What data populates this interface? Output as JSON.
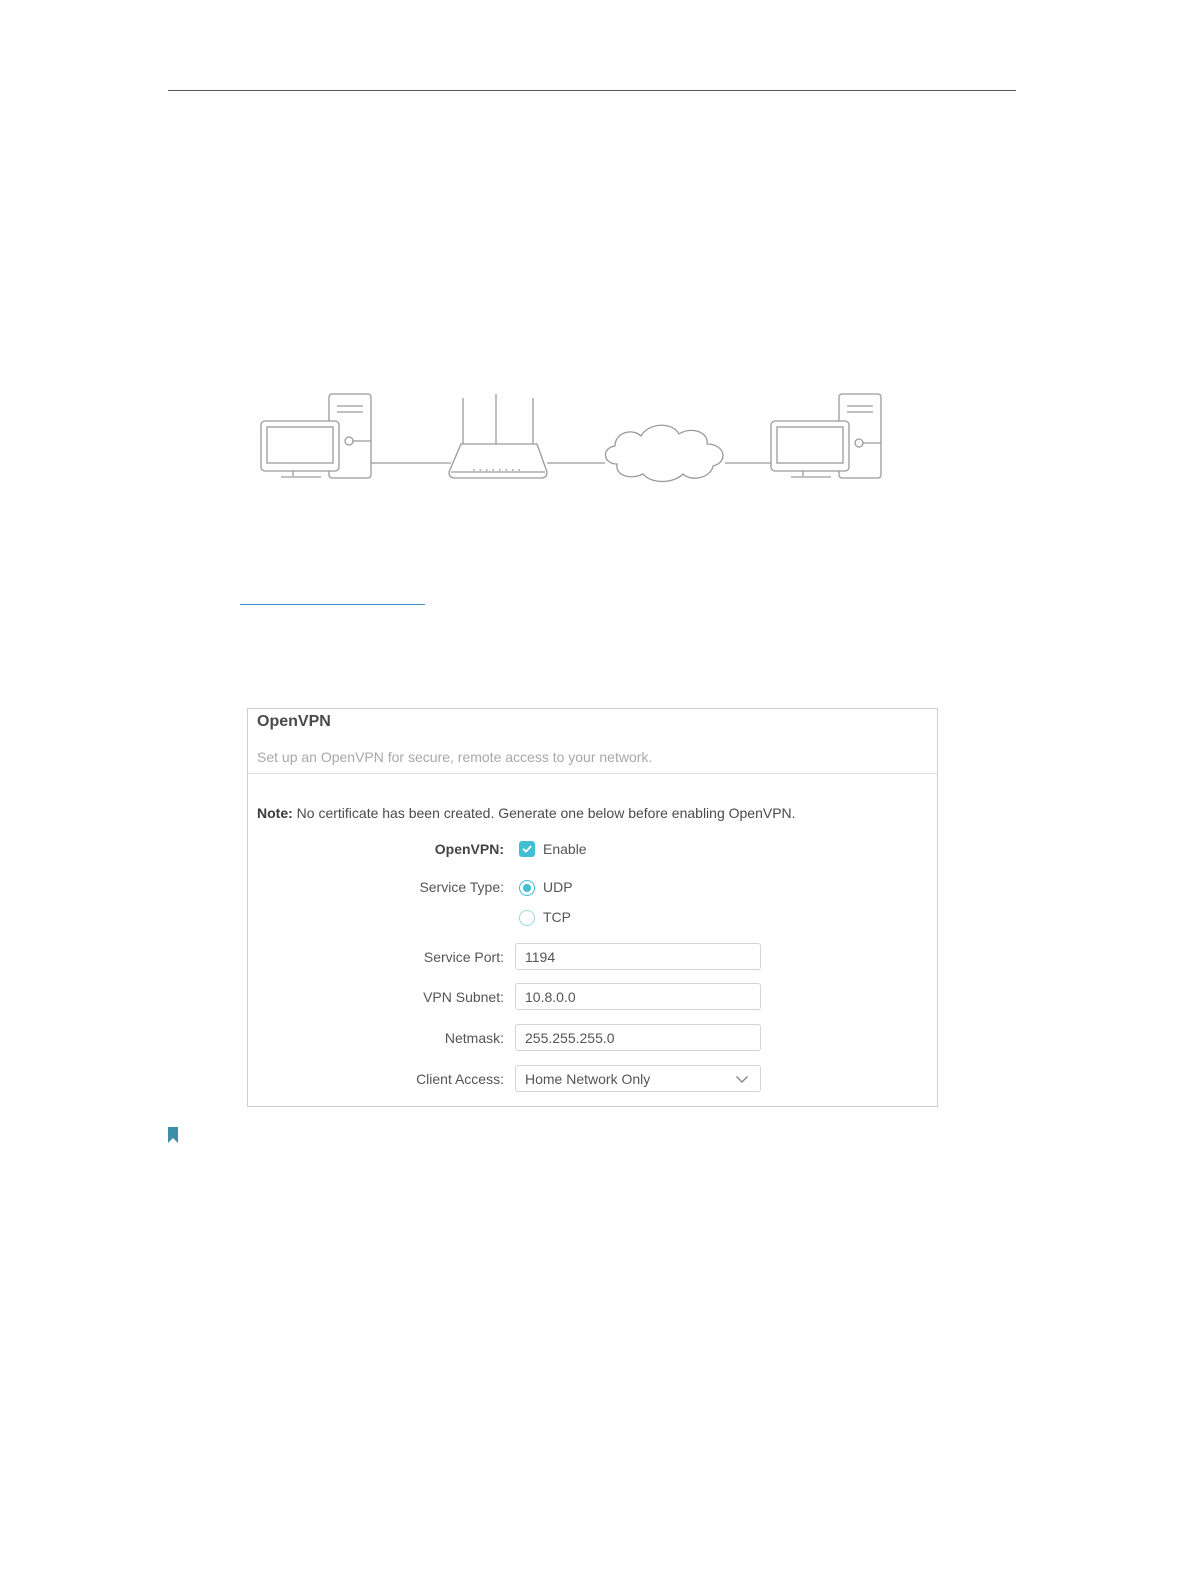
{
  "panel": {
    "title": "OpenVPN",
    "subtitle": "Set up an OpenVPN for secure, remote access to your network.",
    "note_label": "Note:",
    "note_text": " No certificate has been created. Generate one below before enabling OpenVPN."
  },
  "form": {
    "openvpn": {
      "label": "OpenVPN:",
      "option": "Enable",
      "checked": true
    },
    "service_type": {
      "label": "Service Type:",
      "options": [
        "UDP",
        "TCP"
      ],
      "selected": "UDP"
    },
    "service_port": {
      "label": "Service Port:",
      "value": "1194"
    },
    "vpn_subnet": {
      "label": "VPN Subnet:",
      "value": "10.8.0.0"
    },
    "netmask": {
      "label": "Netmask:",
      "value": "255.255.255.0"
    },
    "client_access": {
      "label": "Client Access:",
      "value": "Home Network Only"
    }
  },
  "colors": {
    "accent": "#40c0d2",
    "bookmark": "#3b8fa8",
    "link": "#3a8fc4"
  },
  "icons": {
    "checkbox": "check-icon",
    "dropdown": "chevron-down-icon",
    "note": "bookmark-icon"
  }
}
